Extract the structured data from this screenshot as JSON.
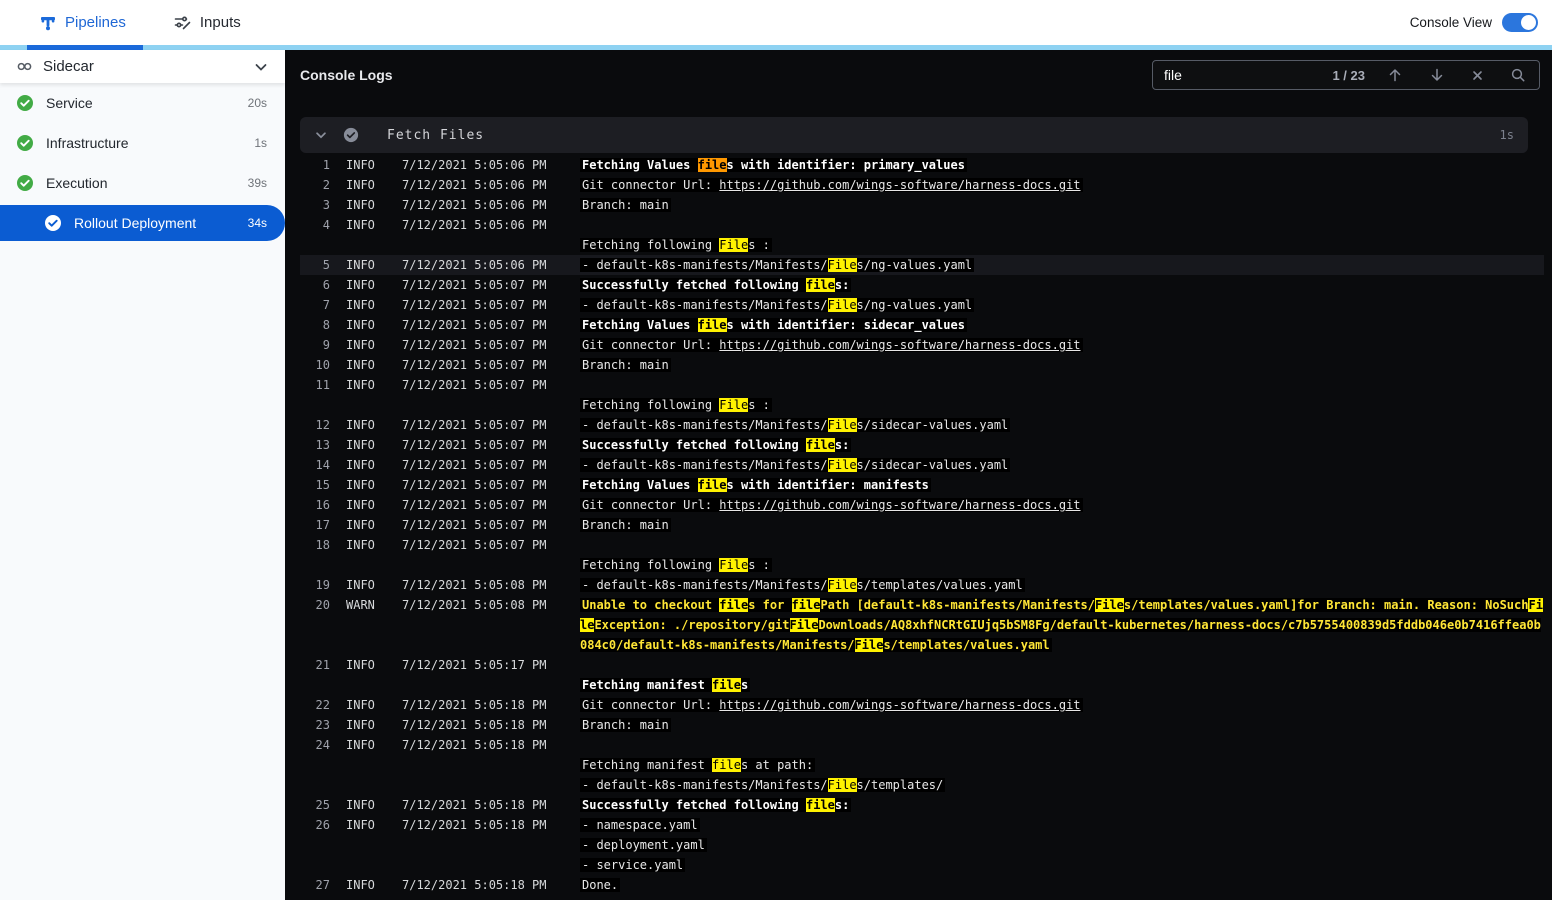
{
  "colors": {
    "accent_blue": "#1b6ada",
    "light_blue_strip": "#8ed2f2",
    "selected_step_bg": "#0b5cd2",
    "success_green": "#42ab45",
    "match_highlight": "#fff200",
    "current_match_highlight": "#ff9800",
    "warn_text": "#ffe636"
  },
  "topbar": {
    "tabs": [
      {
        "label": "Pipelines",
        "active": true
      },
      {
        "label": "Inputs",
        "active": false
      }
    ],
    "console_view_label": "Console View",
    "console_view_on": true
  },
  "sidebar": {
    "stage_label": "Sidecar",
    "items": [
      {
        "label": "Service",
        "duration": "20s",
        "status": "success",
        "selected": false
      },
      {
        "label": "Infrastructure",
        "duration": "1s",
        "status": "success",
        "selected": false
      },
      {
        "label": "Execution",
        "duration": "39s",
        "status": "success",
        "selected": false
      },
      {
        "label": "Rollout Deployment",
        "duration": "34s",
        "status": "success",
        "selected": true
      }
    ]
  },
  "console": {
    "title": "Console Logs",
    "search": {
      "term": "file",
      "position": "1 / 23",
      "current_match": 1
    },
    "section": {
      "title": "Fetch Files",
      "duration": "1s"
    },
    "rows": [
      {
        "n": "1",
        "lvl": "INFO",
        "t": "7/12/2021 5:05:06 PM",
        "text": "Fetching Values files with identifier: primary_values",
        "bold": true
      },
      {
        "n": "2",
        "lvl": "INFO",
        "t": "7/12/2021 5:05:06 PM",
        "text": "Git connector Url: https://github.com/wings-software/harness-docs.git",
        "link": true
      },
      {
        "n": "3",
        "lvl": "INFO",
        "t": "7/12/2021 5:05:06 PM",
        "text": "Branch: main"
      },
      {
        "n": "4",
        "lvl": "INFO",
        "t": "7/12/2021 5:05:06 PM",
        "text": ""
      },
      {
        "n": "",
        "lvl": "",
        "t": "",
        "text": "Fetching following Files :"
      },
      {
        "n": "5",
        "lvl": "INFO",
        "t": "7/12/2021 5:05:06 PM",
        "text": "- default-k8s-manifests/Manifests/Files/ng-values.yaml",
        "sel": true
      },
      {
        "n": "6",
        "lvl": "INFO",
        "t": "7/12/2021 5:05:07 PM",
        "text": "Successfully fetched following files:",
        "bold": true
      },
      {
        "n": "7",
        "lvl": "INFO",
        "t": "7/12/2021 5:05:07 PM",
        "text": "- default-k8s-manifests/Manifests/Files/ng-values.yaml"
      },
      {
        "n": "8",
        "lvl": "INFO",
        "t": "7/12/2021 5:05:07 PM",
        "text": "Fetching Values files with identifier: sidecar_values",
        "bold": true
      },
      {
        "n": "9",
        "lvl": "INFO",
        "t": "7/12/2021 5:05:07 PM",
        "text": "Git connector Url: https://github.com/wings-software/harness-docs.git",
        "link": true
      },
      {
        "n": "10",
        "lvl": "INFO",
        "t": "7/12/2021 5:05:07 PM",
        "text": "Branch: main"
      },
      {
        "n": "11",
        "lvl": "INFO",
        "t": "7/12/2021 5:05:07 PM",
        "text": ""
      },
      {
        "n": "",
        "lvl": "",
        "t": "",
        "text": "Fetching following Files :"
      },
      {
        "n": "12",
        "lvl": "INFO",
        "t": "7/12/2021 5:05:07 PM",
        "text": "- default-k8s-manifests/Manifests/Files/sidecar-values.yaml"
      },
      {
        "n": "13",
        "lvl": "INFO",
        "t": "7/12/2021 5:05:07 PM",
        "text": "Successfully fetched following files:",
        "bold": true
      },
      {
        "n": "14",
        "lvl": "INFO",
        "t": "7/12/2021 5:05:07 PM",
        "text": "- default-k8s-manifests/Manifests/Files/sidecar-values.yaml"
      },
      {
        "n": "15",
        "lvl": "INFO",
        "t": "7/12/2021 5:05:07 PM",
        "text": "Fetching Values files with identifier: manifests",
        "bold": true
      },
      {
        "n": "16",
        "lvl": "INFO",
        "t": "7/12/2021 5:05:07 PM",
        "text": "Git connector Url: https://github.com/wings-software/harness-docs.git",
        "link": true
      },
      {
        "n": "17",
        "lvl": "INFO",
        "t": "7/12/2021 5:05:07 PM",
        "text": "Branch: main"
      },
      {
        "n": "18",
        "lvl": "INFO",
        "t": "7/12/2021 5:05:07 PM",
        "text": ""
      },
      {
        "n": "",
        "lvl": "",
        "t": "",
        "text": "Fetching following Files :"
      },
      {
        "n": "19",
        "lvl": "INFO",
        "t": "7/12/2021 5:05:08 PM",
        "text": "- default-k8s-manifests/Manifests/Files/templates/values.yaml"
      },
      {
        "n": "20",
        "lvl": "WARN",
        "t": "7/12/2021 5:05:08 PM",
        "text": "Unable to checkout files for filePath [default-k8s-manifests/Manifests/Files/templates/values.yaml]for Branch: main. Reason: NoSuchFileException: ./repository/gitFileDownloads/AQ8xhfNCRtGIUjq5bSM8Fg/default-kubernetes/harness-docs/c7b5755400839d5fddb046e0b7416ffea0b084c0/default-k8s-manifests/Manifests/Files/templates/values.yaml",
        "warn": true
      },
      {
        "n": "21",
        "lvl": "INFO",
        "t": "7/12/2021 5:05:17 PM",
        "text": ""
      },
      {
        "n": "",
        "lvl": "",
        "t": "",
        "text": "Fetching manifest files",
        "bold": true
      },
      {
        "n": "22",
        "lvl": "INFO",
        "t": "7/12/2021 5:05:18 PM",
        "text": "Git connector Url: https://github.com/wings-software/harness-docs.git",
        "link": true
      },
      {
        "n": "23",
        "lvl": "INFO",
        "t": "7/12/2021 5:05:18 PM",
        "text": "Branch: main"
      },
      {
        "n": "24",
        "lvl": "INFO",
        "t": "7/12/2021 5:05:18 PM",
        "text": ""
      },
      {
        "n": "",
        "lvl": "",
        "t": "",
        "text": "Fetching manifest files at path:"
      },
      {
        "n": "",
        "lvl": "",
        "t": "",
        "text": "- default-k8s-manifests/Manifests/Files/templates/"
      },
      {
        "n": "25",
        "lvl": "INFO",
        "t": "7/12/2021 5:05:18 PM",
        "text": "Successfully fetched following files:",
        "bold": true
      },
      {
        "n": "26",
        "lvl": "INFO",
        "t": "7/12/2021 5:05:18 PM",
        "text": "- namespace.yaml"
      },
      {
        "n": "",
        "lvl": "",
        "t": "",
        "text": "- deployment.yaml"
      },
      {
        "n": "",
        "lvl": "",
        "t": "",
        "text": "- service.yaml"
      },
      {
        "n": "27",
        "lvl": "INFO",
        "t": "7/12/2021 5:05:18 PM",
        "text": "Done."
      }
    ]
  }
}
